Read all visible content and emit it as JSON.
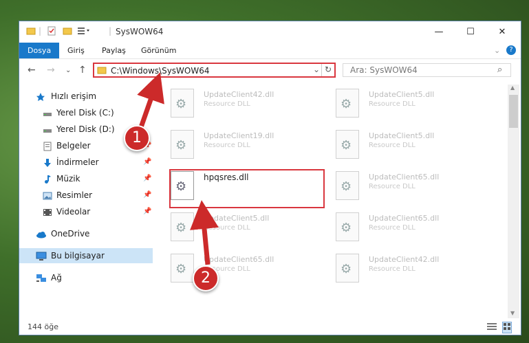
{
  "window": {
    "title": "SysWOW64",
    "minimize": "—",
    "maximize": "☐",
    "close": "✕"
  },
  "ribbon": {
    "tabs": [
      "Dosya",
      "Giriş",
      "Paylaş",
      "Görünüm"
    ],
    "help": "?",
    "expand": "⌄"
  },
  "nav": {
    "back": "←",
    "forward": "→",
    "recent": "⌄",
    "up": "↑",
    "address": "C:\\Windows\\SysWOW64",
    "address_dropdown": "⌄",
    "refresh": "↻",
    "search_placeholder": "Ara: SysWOW64",
    "search_icon": "⌕"
  },
  "sidebar": {
    "items": [
      {
        "label": "Hızlı erişim",
        "icon": "star-icon"
      },
      {
        "label": "Yerel Disk (C:)",
        "icon": "drive-icon"
      },
      {
        "label": "Yerel Disk (D:)",
        "icon": "drive-icon"
      },
      {
        "label": "Belgeler",
        "icon": "document-icon"
      },
      {
        "label": "İndirmeler",
        "icon": "download-icon"
      },
      {
        "label": "Müzik",
        "icon": "music-icon"
      },
      {
        "label": "Resimler",
        "icon": "picture-icon"
      },
      {
        "label": "Videolar",
        "icon": "video-icon"
      },
      {
        "label": "OneDrive",
        "icon": "cloud-icon"
      },
      {
        "label": "Bu bilgisayar",
        "icon": "computer-icon"
      },
      {
        "label": "Ağ",
        "icon": "network-icon"
      }
    ]
  },
  "files": [
    {
      "name": "UpdateClient42.dll",
      "desc": "Resource DLL"
    },
    {
      "name": "UpdateClient5.dll",
      "desc": "Resource DLL"
    },
    {
      "name": "UpdateClient19.dll",
      "desc": "Resource DLL"
    },
    {
      "name": "UpdateClient5.dll",
      "desc": "Resource DLL"
    },
    {
      "name": "hpqsres.dll",
      "desc": ""
    },
    {
      "name": "UpdateClient65.dll",
      "desc": "Resource DLL"
    },
    {
      "name": "UpdateClient5.dll",
      "desc": "Resource DLL"
    },
    {
      "name": "UpdateClient65.dll",
      "desc": "Resource DLL"
    },
    {
      "name": "UpdateClient65.dll",
      "desc": "Resource DLL"
    },
    {
      "name": "UpdateClient42.dll",
      "desc": "Resource DLL"
    }
  ],
  "status": {
    "count": "144 öğe"
  },
  "annotations": {
    "badge1": "1",
    "badge2": "2",
    "color": "#cc2a2a"
  }
}
